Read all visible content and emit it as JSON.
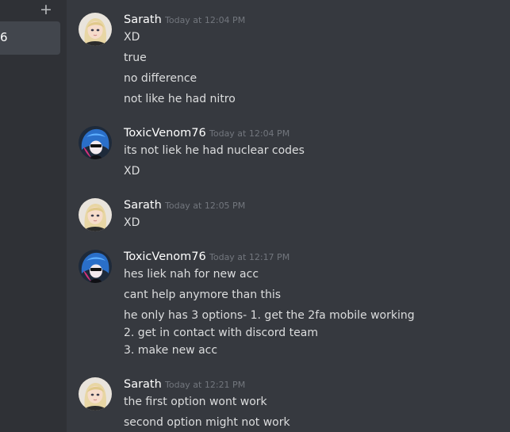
{
  "sidebar": {
    "add_symbol": "+",
    "selected_channel_label": "6"
  },
  "messages": [
    {
      "author": "Sarath",
      "timestamp": "Today at 12:04 PM",
      "avatar": "sarath-avatar",
      "lines": [
        "XD",
        "true",
        "no difference",
        "not like he had nitro"
      ]
    },
    {
      "author": "ToxicVenom76",
      "timestamp": "Today at 12:04 PM",
      "avatar": "toxicvenom-avatar",
      "lines": [
        "its not liek he had nuclear codes",
        "XD"
      ]
    },
    {
      "author": "Sarath",
      "timestamp": "Today at 12:05 PM",
      "avatar": "sarath-avatar",
      "lines": [
        "XD"
      ]
    },
    {
      "author": "ToxicVenom76",
      "timestamp": "Today at 12:17 PM",
      "avatar": "toxicvenom-avatar",
      "lines": [
        "hes liek nah for new acc",
        "cant help anymore than this",
        "he only has 3 options- 1. get the 2fa mobile working",
        "2. get in contact with discord team",
        "3. make new acc"
      ]
    },
    {
      "author": "Sarath",
      "timestamp": "Today at 12:21 PM",
      "avatar": "sarath-avatar",
      "lines": [
        "the first option wont work",
        "second option might not work"
      ]
    }
  ],
  "colors": {
    "background": "#36393f",
    "sidebar": "#2f3136",
    "username": "#ffffff",
    "timestamp": "#72767d",
    "message_text": "#dcddde"
  }
}
